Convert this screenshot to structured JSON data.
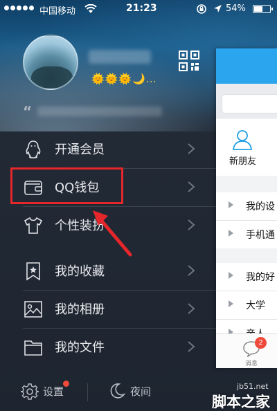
{
  "status_bar": {
    "carrier": "中国移动",
    "time": "21:23",
    "battery_percent": "54%"
  },
  "profile": {
    "level_icons": "🌞🌞🌞🌙…",
    "signature_quote_mark": "“"
  },
  "menu": {
    "items": [
      {
        "label": "开通会员",
        "icon": "penguin-icon"
      },
      {
        "label": "QQ钱包",
        "icon": "wallet-icon"
      },
      {
        "label": "个性装扮",
        "icon": "tshirt-icon"
      },
      {
        "label": "我的收藏",
        "icon": "bookmark-star-icon"
      },
      {
        "label": "我的相册",
        "icon": "photo-icon"
      },
      {
        "label": "我的文件",
        "icon": "folder-icon"
      }
    ]
  },
  "bottom_bar": {
    "settings_label": "设置",
    "night_label": "夜间"
  },
  "main_panel": {
    "new_friend_label": "新朋友",
    "groups": [
      "我的设",
      "手机通",
      "我的好",
      "大学",
      "亲人"
    ],
    "tab_message_label": "消息",
    "tab_message_badge": "2"
  },
  "watermark": {
    "site": "jb51.net",
    "name": "脚本之家"
  },
  "colors": {
    "highlight_box": "#e5262b",
    "header_blue": "#2aa5ee",
    "badge_red": "#f04a3b"
  }
}
